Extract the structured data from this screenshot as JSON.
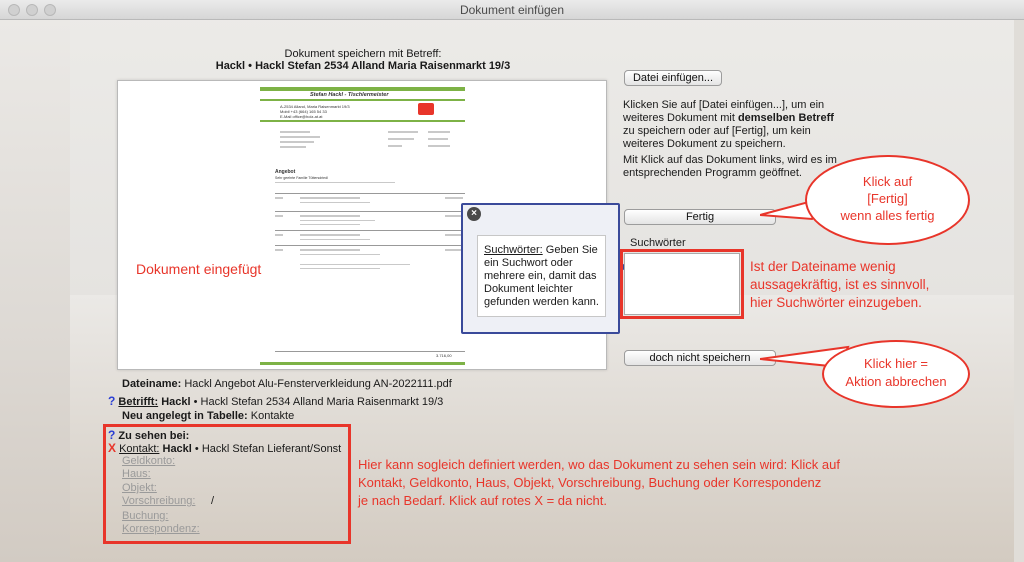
{
  "window": {
    "title": "Dokument einfügen"
  },
  "header": {
    "line1": "Dokument speichern mit Betreff:",
    "line2": "Hackl • Hackl Stefan 2534 Alland Maria Raisenmarkt 19/3"
  },
  "preview": {
    "doc": {
      "company": "Stefan Hackl - Tischlermeister",
      "address1": "A-2534 Alland, Maria Raisenmarkt 19/3",
      "address2": "Mobil +43 (664) 165 54 33",
      "address3": "E-Mail office@holz-at.at",
      "title": "Angebot",
      "greeting": "Sehr geehrte Familie Tüttersdriedl",
      "total": "3.716,00"
    },
    "overlay_label": "Dokument eingefügt"
  },
  "tooltip": {
    "close_glyph": "×",
    "term": "Suchwörter:",
    "text": "Geben Sie ein Suchwort oder mehrere ein, damit das Dokument leichter gefunden werden kann."
  },
  "buttons": {
    "insert_file": "Datei einfügen...",
    "done": "Fertig",
    "dont_save": "doch nicht speichern"
  },
  "instructions": {
    "part1": "Klicken Sie auf [Datei einfügen...], um ein weiteres Dokument mit ",
    "bold": "demselben Betreff",
    "part2": " zu speichern oder auf  [Fertig], um kein weiteres Dokument zu speichern.",
    "part3": "Mit Klick auf das Dokument links, wird es im entsprechenden Programm geöffnet."
  },
  "search": {
    "label": "Suchwörter",
    "value": ""
  },
  "callouts": {
    "done": "Klick auf [Fertig] wenn alles fertig",
    "done_l1": "Klick auf",
    "done_l2": "[Fertig]",
    "done_l3": "wenn alles fertig",
    "cancel_l1": "Klick hier =",
    "cancel_l2": "Aktion abbrechen",
    "keywords_l1": "Ist der Dateiname wenig",
    "keywords_l2": "aussagekräftig, ist es sinnvoll,",
    "keywords_l3": "hier Suchwörter einzugeben.",
    "visibility_l1": "Hier kann sogleich definiert werden, wo das Dokument zu sehen sein wird: Klick auf",
    "visibility_l2": "Kontakt, Geldkonto, Haus, Objekt, Vorschreibung, Buchung oder Korrespondenz",
    "visibility_l3": "je nach Bedarf. Klick auf rotes X = da nicht."
  },
  "info": {
    "filename_label": "Dateiname:",
    "filename_value": "Hackl Angebot Alu-Fensterverkleidung AN-2022111.pdf",
    "subject_label": "Betrifft:",
    "subject_bold": "Hackl",
    "subject_rest": "• Hackl Stefan 2534 Alland Maria Raisenmarkt 19/3",
    "table_label": "Neu angelegt in Tabelle:",
    "table_value": "Kontakte",
    "help_glyph": "?",
    "remove_glyph": "X",
    "visible_label": "Zu sehen bei:",
    "kontakt_label": "Kontakt:",
    "kontakt_bold": "Hackl",
    "kontakt_rest": "• Hackl Stefan Lieferant/Sonst",
    "geldkonto": "Geldkonto:",
    "haus": "Haus:",
    "objekt": "Objekt:",
    "vorschreibung": "Vorschreibung:",
    "vorschreibung_value": "/",
    "buchung": "Buchung:",
    "korrespondenz": "Korrespondenz:"
  },
  "colors": {
    "annotation": "#e8352a",
    "help": "#2a3fd4",
    "accent_green": "#7db246",
    "tooltip_border": "#3a4a9a"
  }
}
